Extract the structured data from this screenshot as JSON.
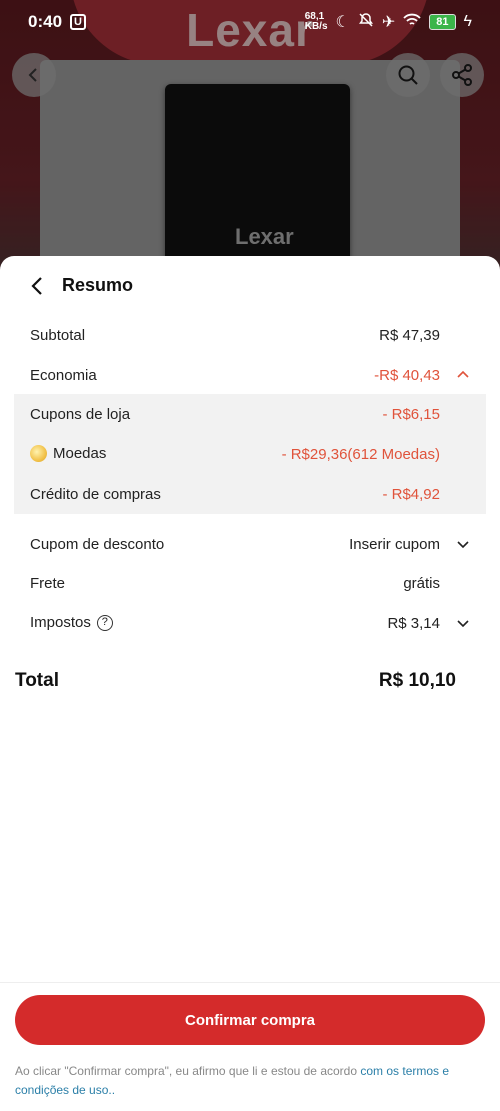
{
  "status_bar": {
    "time": "0:40",
    "u_badge": "U",
    "net_speed_value": "68,1",
    "net_speed_unit": "KB/s",
    "battery": "81"
  },
  "background": {
    "brand": "Lexar",
    "device_brand": "Lexar"
  },
  "sheet": {
    "title": "Resumo",
    "rows": {
      "subtotal": {
        "label": "Subtotal",
        "value": "R$ 47,39"
      },
      "economia": {
        "label": "Economia",
        "value": "-R$ 40,43"
      },
      "cupons_loja": {
        "label": "Cupons de loja",
        "value": "- R$6,15"
      },
      "moedas": {
        "label": "Moedas",
        "value": "- R$29,36(612 Moedas)"
      },
      "credito": {
        "label": "Crédito de compras",
        "value": "- R$4,92"
      },
      "cupom_desconto": {
        "label": "Cupom de desconto",
        "value": "Inserir cupom"
      },
      "frete": {
        "label": "Frete",
        "value": "grátis"
      },
      "impostos": {
        "label": "Impostos",
        "value": "R$ 3,14",
        "help_icon": "?"
      }
    },
    "total": {
      "label": "Total",
      "value": "R$ 10,10"
    }
  },
  "footer": {
    "confirm_label": "Confirmar compra",
    "terms_text": "Ao clicar \"Confirmar compra\", eu afirmo que li e estou de acordo ",
    "terms_link": "com os termos e condições de uso.."
  },
  "colors": {
    "accent": "#d42b2b",
    "discount": "#e0533b",
    "link": "#2b7fa8"
  }
}
